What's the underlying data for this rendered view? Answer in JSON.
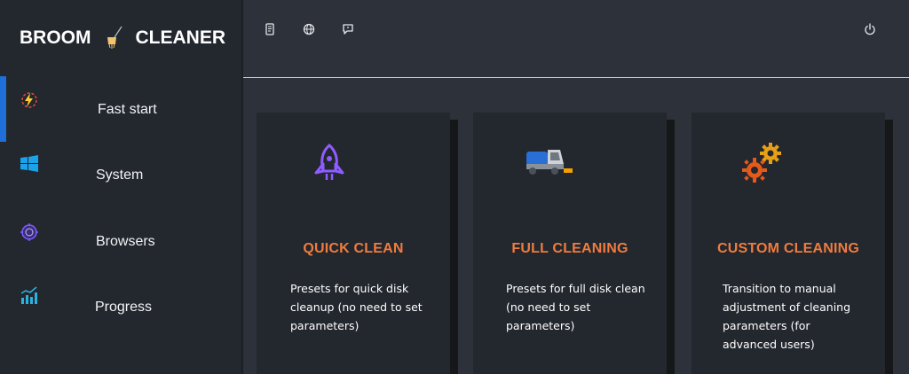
{
  "app": {
    "logo_left": "BROOM",
    "logo_right": "CLEANER"
  },
  "sidebar": {
    "items": [
      {
        "label": "Fast start",
        "icon": "lightning-icon",
        "active": true
      },
      {
        "label": "System",
        "icon": "windows-icon",
        "active": false
      },
      {
        "label": "Browsers",
        "icon": "browser-globe-icon",
        "active": false
      },
      {
        "label": "Progress",
        "icon": "bar-chart-icon",
        "active": false
      }
    ]
  },
  "topbar": {
    "icons": [
      "document-icon",
      "globe-icon",
      "message-icon",
      "power-icon"
    ]
  },
  "cards": [
    {
      "title": "QUICK CLEAN",
      "description": "Presets for quick disk cleanup (no need to set parameters)",
      "icon": "rocket-icon"
    },
    {
      "title": "FULL CLEANING",
      "description": "Presets for full disk clean (no need to set parameters)",
      "icon": "street-sweeper-icon"
    },
    {
      "title": "CUSTOM CLEANING",
      "description": "Transition to manual adjustment of cleaning parameters (for advanced users)",
      "icon": "gears-icon"
    }
  ],
  "colors": {
    "background": "#2c313a",
    "sidebar": "#23272e",
    "accent": "#1e6fd9",
    "title_orange": "#ef7c3e"
  }
}
